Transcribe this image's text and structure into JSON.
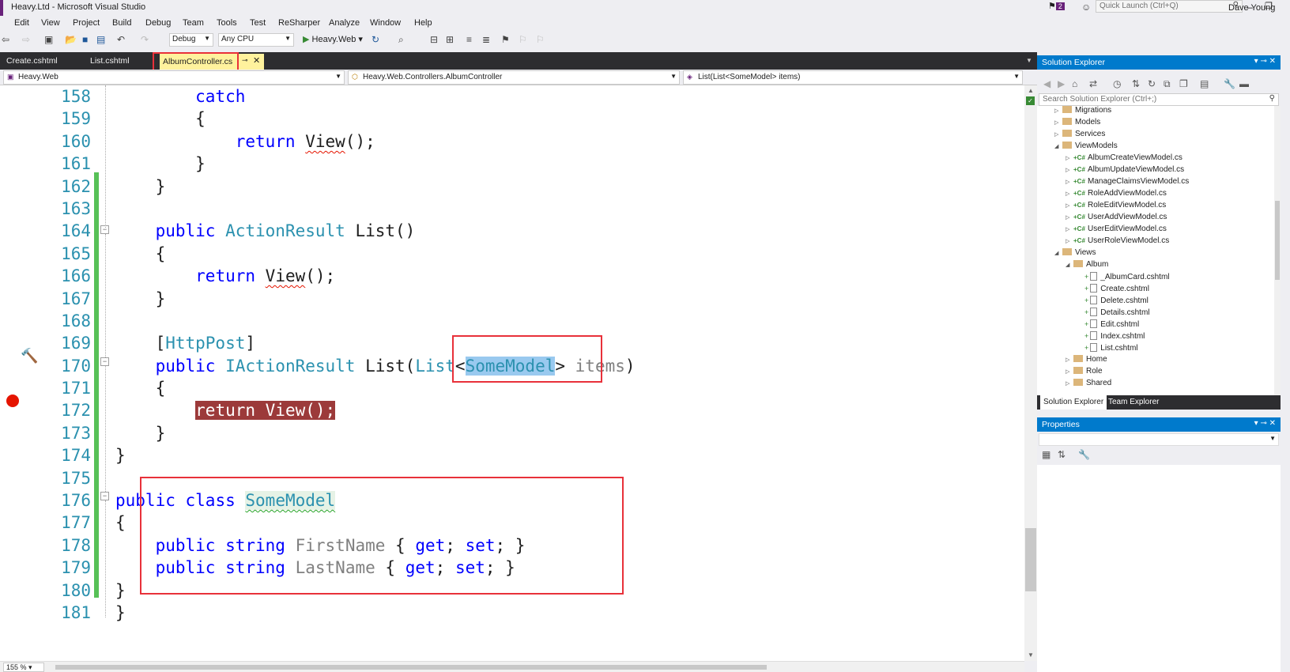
{
  "window": {
    "title": "Heavy.Ltd - Microsoft Visual Studio",
    "notifications_count": "2",
    "quick_launch_placeholder": "Quick Launch (Ctrl+Q)",
    "user": "Dave Young"
  },
  "menu": [
    "Edit",
    "View",
    "Project",
    "Build",
    "Debug",
    "Team",
    "Tools",
    "Test",
    "ReSharper",
    "Analyze",
    "Window",
    "Help"
  ],
  "toolbar": {
    "configuration": "Debug",
    "platform": "Any CPU",
    "start_label": "Heavy.Web"
  },
  "tabs": {
    "items": [
      "Create.cshtml",
      "List.cshtml"
    ],
    "active": "AlbumController.cs"
  },
  "navbar": {
    "project": "Heavy.Web",
    "type": "Heavy.Web.Controllers.AlbumController",
    "member": "List(List<SomeModel> items)"
  },
  "editor": {
    "zoom": "155 %",
    "lines": [
      {
        "n": "158",
        "segs": [
          {
            "t": "        catch",
            "c": "kw"
          }
        ]
      },
      {
        "n": "159",
        "segs": [
          {
            "t": "        {",
            "c": "plain"
          }
        ]
      },
      {
        "n": "160",
        "segs": [
          {
            "t": "            ",
            "c": "plain"
          },
          {
            "t": "return",
            "c": "kw"
          },
          {
            "t": " ",
            "c": "plain"
          },
          {
            "t": "View",
            "c": "plain sq-red"
          },
          {
            "t": "();",
            "c": "plain"
          }
        ]
      },
      {
        "n": "161",
        "segs": [
          {
            "t": "        }",
            "c": "plain"
          }
        ]
      },
      {
        "n": "162",
        "segs": [
          {
            "t": "    }",
            "c": "plain"
          }
        ]
      },
      {
        "n": "163",
        "segs": [
          {
            "t": "",
            "c": "plain"
          }
        ]
      },
      {
        "n": "164",
        "segs": [
          {
            "t": "    ",
            "c": "plain"
          },
          {
            "t": "public",
            "c": "kw"
          },
          {
            "t": " ",
            "c": "plain"
          },
          {
            "t": "ActionResult",
            "c": "ty"
          },
          {
            "t": " List()",
            "c": "plain"
          }
        ]
      },
      {
        "n": "165",
        "segs": [
          {
            "t": "    {",
            "c": "plain"
          }
        ]
      },
      {
        "n": "166",
        "segs": [
          {
            "t": "        ",
            "c": "plain"
          },
          {
            "t": "return",
            "c": "kw"
          },
          {
            "t": " ",
            "c": "plain"
          },
          {
            "t": "View",
            "c": "plain sq-red"
          },
          {
            "t": "();",
            "c": "plain"
          }
        ]
      },
      {
        "n": "167",
        "segs": [
          {
            "t": "    }",
            "c": "plain"
          }
        ]
      },
      {
        "n": "168",
        "segs": [
          {
            "t": "",
            "c": "plain"
          }
        ]
      },
      {
        "n": "169",
        "segs": [
          {
            "t": "    [",
            "c": "plain"
          },
          {
            "t": "HttpPost",
            "c": "attr"
          },
          {
            "t": "]",
            "c": "plain"
          }
        ]
      },
      {
        "n": "170",
        "segs": [
          {
            "t": "    ",
            "c": "plain"
          },
          {
            "t": "public",
            "c": "kw"
          },
          {
            "t": " ",
            "c": "plain"
          },
          {
            "t": "IActionResult",
            "c": "ty"
          },
          {
            "t": " List(",
            "c": "plain"
          },
          {
            "t": "List",
            "c": "ty"
          },
          {
            "t": "<",
            "c": "plain"
          },
          {
            "t": "SomeModel",
            "c": "ty sel"
          },
          {
            "t": "> ",
            "c": "plain"
          },
          {
            "t": "items",
            "c": "gray"
          },
          {
            "t": ")",
            "c": "plain"
          }
        ]
      },
      {
        "n": "171",
        "segs": [
          {
            "t": "    {",
            "c": "plain"
          }
        ]
      },
      {
        "n": "172",
        "segs": [
          {
            "t": "        ",
            "c": "plain"
          },
          {
            "t": "return View();",
            "c": "bp-line"
          }
        ]
      },
      {
        "n": "173",
        "segs": [
          {
            "t": "    }",
            "c": "plain"
          }
        ]
      },
      {
        "n": "174",
        "segs": [
          {
            "t": "}",
            "c": "plain"
          }
        ]
      },
      {
        "n": "175",
        "segs": [
          {
            "t": "",
            "c": "plain"
          }
        ]
      },
      {
        "n": "176",
        "segs": [
          {
            "t": "public",
            "c": "kw"
          },
          {
            "t": " ",
            "c": "plain"
          },
          {
            "t": "class",
            "c": "kw"
          },
          {
            "t": " ",
            "c": "plain"
          },
          {
            "t": "SomeModel",
            "c": "ty sq-green"
          }
        ]
      },
      {
        "n": "177",
        "segs": [
          {
            "t": "{",
            "c": "plain"
          }
        ]
      },
      {
        "n": "178",
        "segs": [
          {
            "t": "    ",
            "c": "plain"
          },
          {
            "t": "public",
            "c": "kw"
          },
          {
            "t": " ",
            "c": "plain"
          },
          {
            "t": "string",
            "c": "kw"
          },
          {
            "t": " ",
            "c": "plain"
          },
          {
            "t": "FirstName",
            "c": "gray"
          },
          {
            "t": " { ",
            "c": "plain"
          },
          {
            "t": "get",
            "c": "kw"
          },
          {
            "t": "; ",
            "c": "plain"
          },
          {
            "t": "set",
            "c": "kw"
          },
          {
            "t": "; }",
            "c": "plain"
          }
        ]
      },
      {
        "n": "179",
        "segs": [
          {
            "t": "    ",
            "c": "plain"
          },
          {
            "t": "public",
            "c": "kw"
          },
          {
            "t": " ",
            "c": "plain"
          },
          {
            "t": "string",
            "c": "kw"
          },
          {
            "t": " ",
            "c": "plain"
          },
          {
            "t": "LastName",
            "c": "gray"
          },
          {
            "t": " { ",
            "c": "plain"
          },
          {
            "t": "get",
            "c": "kw"
          },
          {
            "t": "; ",
            "c": "plain"
          },
          {
            "t": "set",
            "c": "kw"
          },
          {
            "t": "; }",
            "c": "plain"
          }
        ]
      },
      {
        "n": "180",
        "segs": [
          {
            "t": "}",
            "c": "plain"
          }
        ]
      },
      {
        "n": "181",
        "segs": [
          {
            "t": "}",
            "c": "plain"
          }
        ]
      }
    ]
  },
  "solution_explorer": {
    "title": "Solution Explorer",
    "search_placeholder": "Search Solution Explorer (Ctrl+;)",
    "items": [
      {
        "label": "Migrations",
        "kind": "folder",
        "depth": 1,
        "state": "collapsed"
      },
      {
        "label": "Models",
        "kind": "folder",
        "depth": 1,
        "state": "collapsed"
      },
      {
        "label": "Services",
        "kind": "folder",
        "depth": 1,
        "state": "collapsed"
      },
      {
        "label": "ViewModels",
        "kind": "folder",
        "depth": 1,
        "state": "expanded"
      },
      {
        "label": "AlbumCreateViewModel.cs",
        "kind": "cs",
        "depth": 2,
        "state": "collapsed"
      },
      {
        "label": "AlbumUpdateViewModel.cs",
        "kind": "cs",
        "depth": 2,
        "state": "collapsed"
      },
      {
        "label": "ManageClaimsViewModel.cs",
        "kind": "cs",
        "depth": 2,
        "state": "collapsed"
      },
      {
        "label": "RoleAddViewModel.cs",
        "kind": "cs",
        "depth": 2,
        "state": "collapsed"
      },
      {
        "label": "RoleEditViewModel.cs",
        "kind": "cs",
        "depth": 2,
        "state": "collapsed"
      },
      {
        "label": "UserAddViewModel.cs",
        "kind": "cs",
        "depth": 2,
        "state": "collapsed"
      },
      {
        "label": "UserEditViewModel.cs",
        "kind": "cs",
        "depth": 2,
        "state": "collapsed"
      },
      {
        "label": "UserRoleViewModel.cs",
        "kind": "cs",
        "depth": 2,
        "state": "collapsed"
      },
      {
        "label": "Views",
        "kind": "folder",
        "depth": 1,
        "state": "expanded"
      },
      {
        "label": "Album",
        "kind": "folder",
        "depth": 2,
        "state": "expanded"
      },
      {
        "label": "_AlbumCard.cshtml",
        "kind": "file",
        "depth": 3,
        "state": "none"
      },
      {
        "label": "Create.cshtml",
        "kind": "file",
        "depth": 3,
        "state": "none"
      },
      {
        "label": "Delete.cshtml",
        "kind": "file",
        "depth": 3,
        "state": "none"
      },
      {
        "label": "Details.cshtml",
        "kind": "file",
        "depth": 3,
        "state": "none"
      },
      {
        "label": "Edit.cshtml",
        "kind": "file",
        "depth": 3,
        "state": "none"
      },
      {
        "label": "Index.cshtml",
        "kind": "file",
        "depth": 3,
        "state": "none"
      },
      {
        "label": "List.cshtml",
        "kind": "file",
        "depth": 3,
        "state": "none"
      },
      {
        "label": "Home",
        "kind": "folder",
        "depth": 2,
        "state": "collapsed"
      },
      {
        "label": "Role",
        "kind": "folder",
        "depth": 2,
        "state": "collapsed"
      },
      {
        "label": "Shared",
        "kind": "folder",
        "depth": 2,
        "state": "collapsed"
      }
    ],
    "tabs": [
      "Solution Explorer",
      "Team Explorer"
    ]
  },
  "properties": {
    "title": "Properties"
  },
  "colors": {
    "accent": "#007acc",
    "highlight_box": "#e8313a",
    "breakpoint": "#e51400",
    "change_bar": "#57c157"
  }
}
